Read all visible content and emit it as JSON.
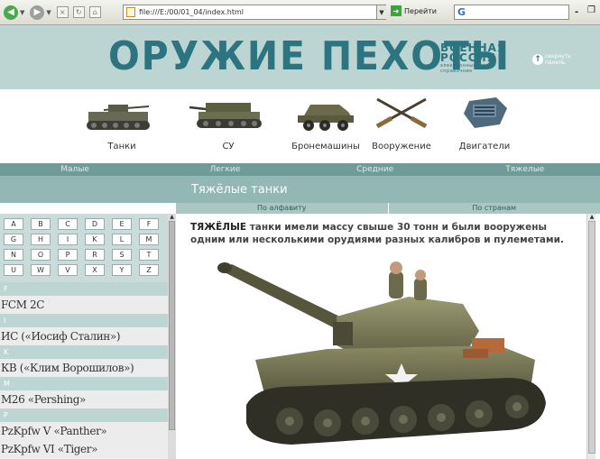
{
  "browser": {
    "url": "file:///E:/00/01_04/index.html",
    "go_label": "Перейти",
    "search_value": "G"
  },
  "header": {
    "title": "ОРУЖИЕ ПЕХОТЫ",
    "logo_line1": "ВОЕННАЯ",
    "logo_line2": "РОССИЯ",
    "logo_line3": "электронный",
    "logo_line4": "справочник",
    "collapse_line1": "свернуть",
    "collapse_line2": "панель"
  },
  "categories": [
    {
      "label": "Танки",
      "icon": "tank-icon"
    },
    {
      "label": "СУ",
      "icon": "self-propelled-gun-icon"
    },
    {
      "label": "Бронемашины",
      "icon": "armored-car-icon"
    },
    {
      "label": "Вооружение",
      "icon": "crossed-rifles-icon"
    },
    {
      "label": "Двигатели",
      "icon": "engine-icon"
    }
  ],
  "weight_tabs": [
    "Малые",
    "Легкие",
    "Средние",
    "Тяжелые"
  ],
  "page_title": "Тяжёлые танки",
  "sort": {
    "by_alphabet": "По алфавиту",
    "by_country": "По странам"
  },
  "alphabet": [
    [
      "A",
      "B",
      "C",
      "D",
      "E",
      "F"
    ],
    [
      "G",
      "H",
      "I",
      "K",
      "L",
      "M"
    ],
    [
      "N",
      "O",
      "P",
      "R",
      "S",
      "T"
    ],
    [
      "U",
      "W",
      "V",
      "X",
      "Y",
      "Z"
    ]
  ],
  "tank_groups": [
    {
      "letter": "F",
      "items": [
        "FCM 2C"
      ]
    },
    {
      "letter": "I",
      "items": [
        "ИС («Иосиф Сталин»)"
      ]
    },
    {
      "letter": "K",
      "items": [
        "КВ («Клим Ворошилов»)"
      ]
    },
    {
      "letter": "M",
      "items": [
        "M26 «Pershing»"
      ]
    },
    {
      "letter": "P",
      "items": [
        "PzKpfw V «Panther»",
        "PzKpfw VI «Tiger»"
      ]
    }
  ],
  "intro": {
    "lead": "ТЯЖЁЛЫЕ",
    "text": " танки имели массу свыше 30 тонн и были вооружены одним или несколькими орудиями разных калибров и пулеметами."
  },
  "colors": {
    "header_bg": "#bcd4d2",
    "title_color": "#2b7480",
    "strip_bg": "#6f9c99",
    "titlebar_bg": "#93b7b4"
  }
}
